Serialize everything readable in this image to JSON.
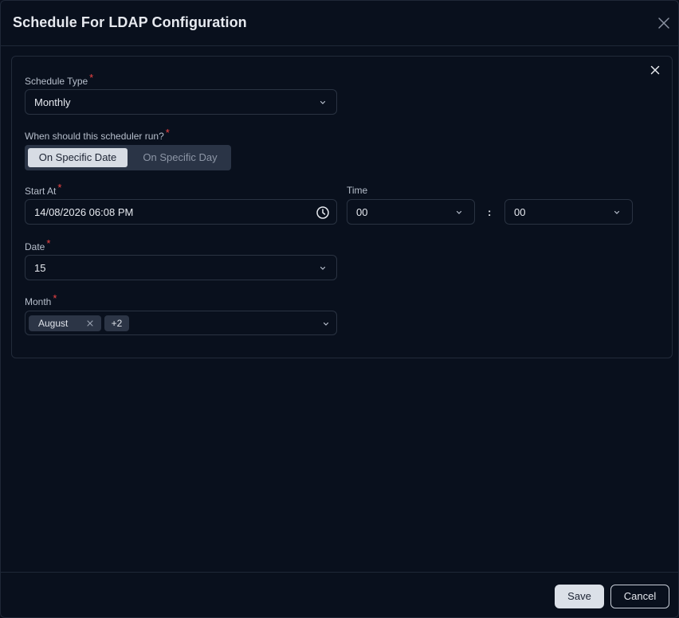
{
  "modal": {
    "title": "Schedule For LDAP Configuration"
  },
  "form": {
    "schedule_type": {
      "label": "Schedule Type",
      "value": "Monthly"
    },
    "run_mode": {
      "label": "When should this scheduler run?",
      "options": [
        "On Specific Date",
        "On Specific Day"
      ],
      "selected": "On Specific Date"
    },
    "start_at": {
      "label": "Start At",
      "value": "14/08/2026 06:08 PM"
    },
    "time": {
      "label": "Time",
      "hour": "00",
      "separator": ":",
      "minute": "00"
    },
    "date": {
      "label": "Date",
      "value": "15"
    },
    "month": {
      "label": "Month",
      "tag": "August",
      "more": "+2"
    },
    "required_marker": "*"
  },
  "footer": {
    "save_label": "Save",
    "cancel_label": "Cancel"
  },
  "colors": {
    "background": "#09101d",
    "border": "#2a3342",
    "required": "#ef4444",
    "active_segment": "#d7dce4"
  }
}
